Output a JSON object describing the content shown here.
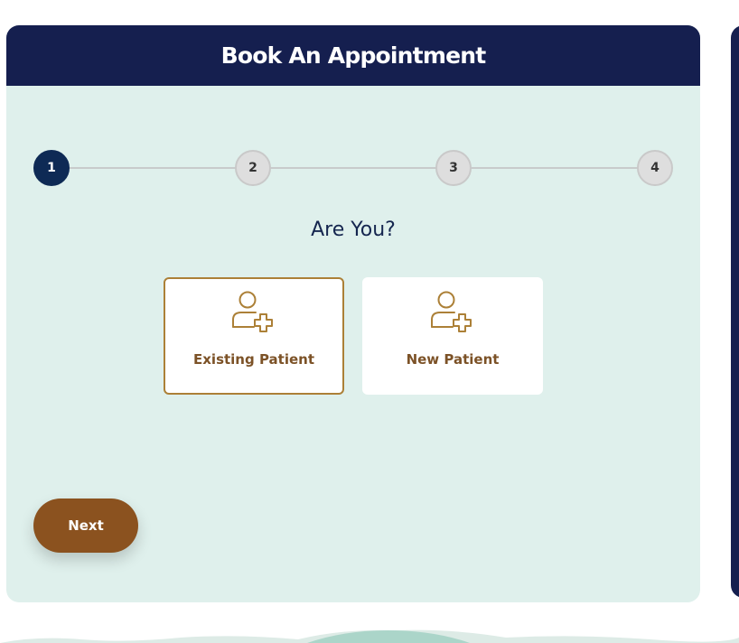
{
  "booking": {
    "title": "Book An Appointment",
    "steps": [
      "1",
      "2",
      "3",
      "4"
    ],
    "active_step": 1,
    "question": "Are You?",
    "options": [
      {
        "label": "Existing Patient",
        "icon": "user-plus-icon",
        "selected": true
      },
      {
        "label": "New Patient",
        "icon": "user-plus-icon",
        "selected": false
      }
    ],
    "next_label": "Next"
  },
  "colors": {
    "header": "#151f4f",
    "card_bg": "#dff0ec",
    "active_step": "#0e2a55",
    "accent_gold": "#ac8037",
    "button_brown": "#8b521f"
  }
}
